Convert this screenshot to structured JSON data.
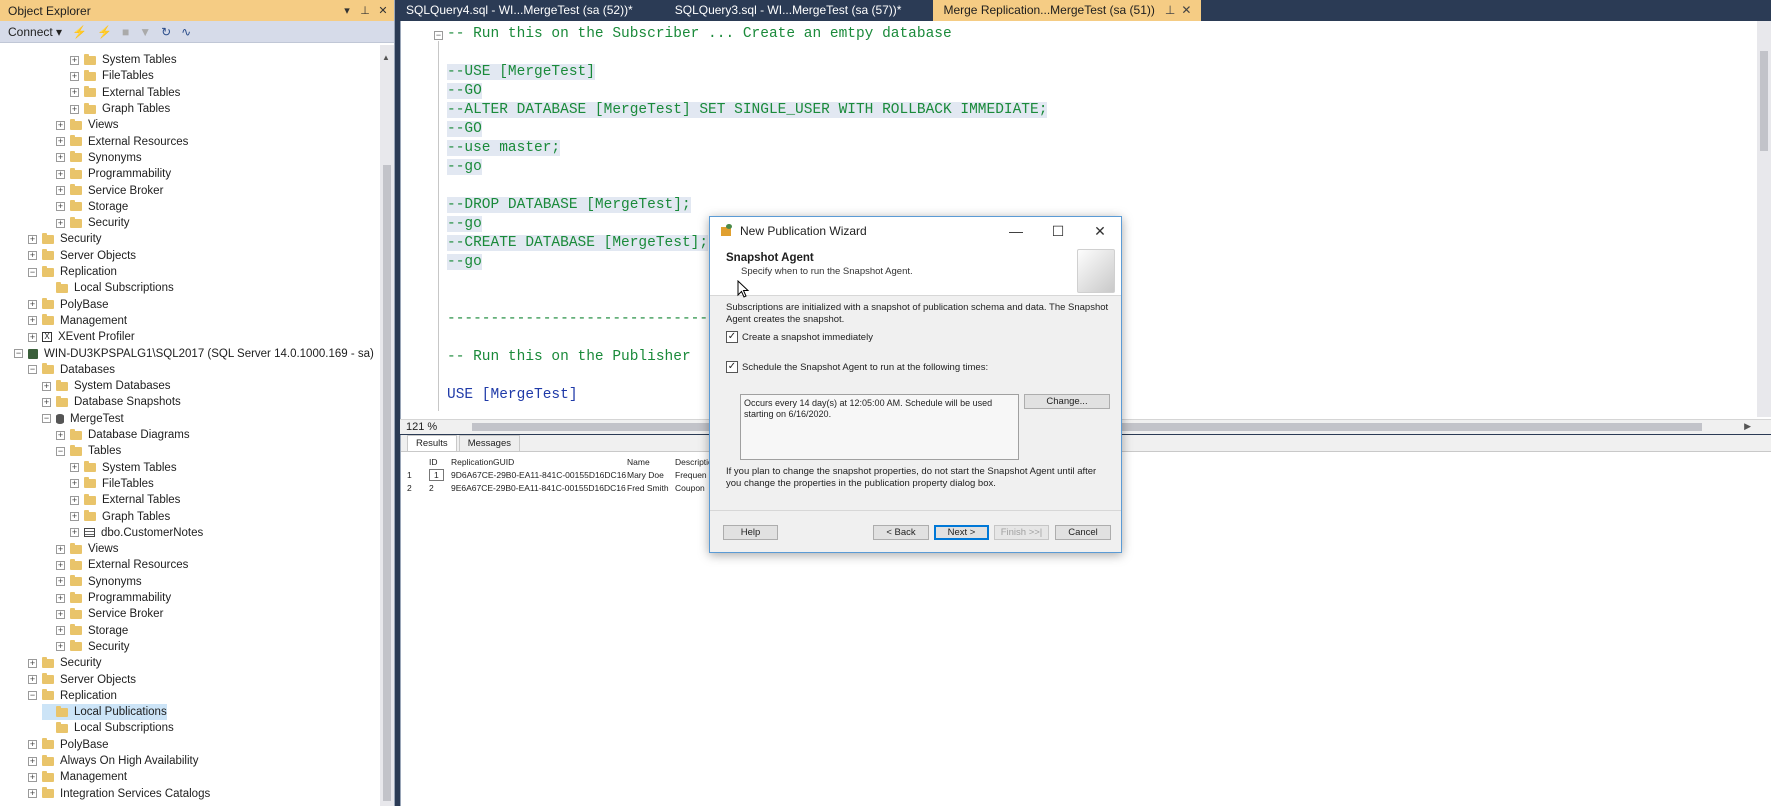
{
  "object_explorer": {
    "title": "Object Explorer",
    "pin_glyph": "⊥",
    "close_glyph": "✕",
    "dropdown_glyph": "▾",
    "connect_label": "Connect ▾",
    "tree": [
      {
        "label": "System Tables",
        "indent": 4,
        "kind": "folder"
      },
      {
        "label": "FileTables",
        "indent": 4,
        "kind": "folder"
      },
      {
        "label": "External Tables",
        "indent": 4,
        "kind": "folder"
      },
      {
        "label": "Graph Tables",
        "indent": 4,
        "kind": "folder"
      },
      {
        "label": "Views",
        "indent": 3,
        "kind": "folder"
      },
      {
        "label": "External Resources",
        "indent": 3,
        "kind": "folder"
      },
      {
        "label": "Synonyms",
        "indent": 3,
        "kind": "folder"
      },
      {
        "label": "Programmability",
        "indent": 3,
        "kind": "folder"
      },
      {
        "label": "Service Broker",
        "indent": 3,
        "kind": "folder"
      },
      {
        "label": "Storage",
        "indent": 3,
        "kind": "folder"
      },
      {
        "label": "Security",
        "indent": 3,
        "kind": "folder"
      },
      {
        "label": "Security",
        "indent": 1,
        "kind": "folder"
      },
      {
        "label": "Server Objects",
        "indent": 1,
        "kind": "folder"
      },
      {
        "label": "Replication",
        "indent": 1,
        "kind": "folder",
        "expanded": true
      },
      {
        "label": "Local Subscriptions",
        "indent": 2,
        "kind": "folder",
        "leaf": true
      },
      {
        "label": "PolyBase",
        "indent": 1,
        "kind": "folder"
      },
      {
        "label": "Management",
        "indent": 1,
        "kind": "folder"
      },
      {
        "label": "XEvent Profiler",
        "indent": 1,
        "kind": "xe"
      },
      {
        "label": "WIN-DU3KPSPALG1\\SQL2017 (SQL Server 14.0.1000.169 - sa)",
        "indent": 0,
        "kind": "server",
        "expanded": true
      },
      {
        "label": "Databases",
        "indent": 1,
        "kind": "folder",
        "expanded": true
      },
      {
        "label": "System Databases",
        "indent": 2,
        "kind": "folder"
      },
      {
        "label": "Database Snapshots",
        "indent": 2,
        "kind": "folder"
      },
      {
        "label": "MergeTest",
        "indent": 2,
        "kind": "db",
        "expanded": true
      },
      {
        "label": "Database Diagrams",
        "indent": 3,
        "kind": "folder"
      },
      {
        "label": "Tables",
        "indent": 3,
        "kind": "folder",
        "expanded": true
      },
      {
        "label": "System Tables",
        "indent": 4,
        "kind": "folder"
      },
      {
        "label": "FileTables",
        "indent": 4,
        "kind": "folder"
      },
      {
        "label": "External Tables",
        "indent": 4,
        "kind": "folder"
      },
      {
        "label": "Graph Tables",
        "indent": 4,
        "kind": "folder"
      },
      {
        "label": "dbo.CustomerNotes",
        "indent": 4,
        "kind": "table"
      },
      {
        "label": "Views",
        "indent": 3,
        "kind": "folder"
      },
      {
        "label": "External Resources",
        "indent": 3,
        "kind": "folder"
      },
      {
        "label": "Synonyms",
        "indent": 3,
        "kind": "folder"
      },
      {
        "label": "Programmability",
        "indent": 3,
        "kind": "folder"
      },
      {
        "label": "Service Broker",
        "indent": 3,
        "kind": "folder"
      },
      {
        "label": "Storage",
        "indent": 3,
        "kind": "folder"
      },
      {
        "label": "Security",
        "indent": 3,
        "kind": "folder"
      },
      {
        "label": "Security",
        "indent": 1,
        "kind": "folder"
      },
      {
        "label": "Server Objects",
        "indent": 1,
        "kind": "folder"
      },
      {
        "label": "Replication",
        "indent": 1,
        "kind": "folder",
        "expanded": true
      },
      {
        "label": "Local Publications",
        "indent": 2,
        "kind": "folder",
        "leaf": true,
        "selected": true
      },
      {
        "label": "Local Subscriptions",
        "indent": 2,
        "kind": "folder",
        "leaf": true
      },
      {
        "label": "PolyBase",
        "indent": 1,
        "kind": "folder"
      },
      {
        "label": "Always On High Availability",
        "indent": 1,
        "kind": "folder"
      },
      {
        "label": "Management",
        "indent": 1,
        "kind": "folder"
      },
      {
        "label": "Integration Services Catalogs",
        "indent": 1,
        "kind": "folder"
      }
    ]
  },
  "tabs": [
    {
      "label": "SQLQuery4.sql - WI...MergeTest (sa (52))*",
      "active": false
    },
    {
      "label": "SQLQuery3.sql - WI...MergeTest (sa (57))*",
      "active": false
    },
    {
      "label": "Merge Replication...MergeTest (sa (51))",
      "active": true
    }
  ],
  "tab_icons": {
    "pin": "⊥",
    "close": "✕"
  },
  "editor": {
    "lines": [
      {
        "text": "-- Run this on the Subscriber ... Create an emtpy database",
        "hl": false,
        "kind": "comment"
      },
      {
        "text": "",
        "hl": false,
        "kind": "comment"
      },
      {
        "text": "--USE [MergeTest]",
        "hl": true,
        "kind": "comment"
      },
      {
        "text": "--GO",
        "hl": true,
        "kind": "comment"
      },
      {
        "text": "--ALTER DATABASE [MergeTest] SET SINGLE_USER WITH ROLLBACK IMMEDIATE;",
        "hl": true,
        "kind": "comment"
      },
      {
        "text": "--GO",
        "hl": true,
        "kind": "comment"
      },
      {
        "text": "--use master;",
        "hl": true,
        "kind": "comment"
      },
      {
        "text": "--go",
        "hl": true,
        "kind": "comment"
      },
      {
        "text": "",
        "hl": true,
        "kind": "comment"
      },
      {
        "text": "--DROP DATABASE [MergeTest];",
        "hl": true,
        "kind": "comment"
      },
      {
        "text": "--go",
        "hl": true,
        "kind": "comment"
      },
      {
        "text": "--CREATE DATABASE [MergeTest];",
        "hl": true,
        "kind": "comment"
      },
      {
        "text": "--go",
        "hl": true,
        "kind": "comment"
      },
      {
        "text": "",
        "hl": false,
        "kind": "comment"
      },
      {
        "text": "",
        "hl": false,
        "kind": "comment"
      },
      {
        "text": "----------------------------------",
        "hl": false,
        "kind": "comment"
      },
      {
        "text": "",
        "hl": false,
        "kind": "comment"
      },
      {
        "text": "-- Run this on the Publisher",
        "hl": false,
        "kind": "comment"
      },
      {
        "text": "",
        "hl": false,
        "kind": "comment"
      },
      {
        "text": "USE [MergeTest]",
        "hl": false,
        "kind": "kw"
      }
    ],
    "zoom": "121 %"
  },
  "results": {
    "tabs": [
      "Results",
      "Messages"
    ],
    "columns": [
      "",
      "ID",
      "ReplicationGUID",
      "Name",
      "Descriptio"
    ],
    "rows": [
      [
        "1",
        "1",
        "9D6A67CE-29B0-EA11-841C-00155D16DC16",
        "Mary Doe",
        "Frequen"
      ],
      [
        "2",
        "2",
        "9E6A67CE-29B0-EA11-841C-00155D16DC16",
        "Fred Smith",
        "Coupon"
      ]
    ]
  },
  "dialog": {
    "title": "New Publication Wizard",
    "header_title": "Snapshot Agent",
    "header_subtitle": "Specify when to run the Snapshot Agent.",
    "intro": "Subscriptions are initialized with a snapshot of publication schema and data. The Snapshot Agent creates the snapshot.",
    "create_snapshot_label": "Create a snapshot immediately",
    "create_snapshot_checked": true,
    "schedule_label": "Schedule the Snapshot Agent to run at the following times:",
    "schedule_checked": true,
    "schedule_text": "Occurs every 14 day(s) at 12:05:00 AM. Schedule will be used starting on 6/16/2020.",
    "change_button": "Change...",
    "note": "If you plan to change the snapshot properties, do not start the Snapshot Agent until after you change the properties in the publication property dialog box.",
    "help_button": "Help",
    "back_button": "< Back",
    "next_button": "Next >",
    "finish_button": "Finish >>|",
    "cancel_button": "Cancel",
    "check_glyph": "✓",
    "minimize_glyph": "—",
    "maximize_glyph": "☐",
    "close_glyph": "✕"
  },
  "colors": {
    "title_bar": "#2b3b55",
    "active_tab": "#f5cc84",
    "comment_green": "#1a8a3a",
    "keyword_blue": "#1f3aa8"
  }
}
